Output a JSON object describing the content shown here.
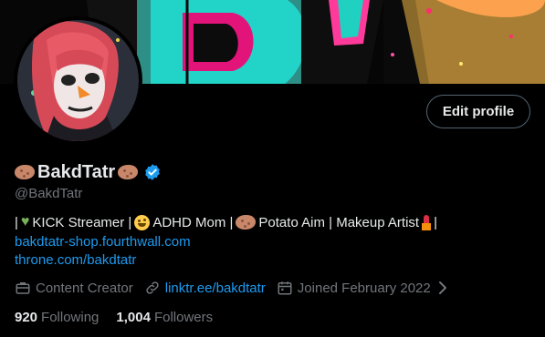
{
  "profile": {
    "display_name": "BakdTatr",
    "handle": "@BakdTatr",
    "verified": true,
    "edit_button_label": "Edit profile"
  },
  "bio": {
    "prefix": "|",
    "part1": "KICK Streamer |",
    "part2": "ADHD Mom |",
    "part3": "Potato Aim | Makeup Artist",
    "suffix": "|",
    "links": [
      "bakdtatr-shop.fourthwall.com",
      "throne.com/bakdtatr"
    ]
  },
  "meta": {
    "category": "Content Creator",
    "website": "linktr.ee/bakdtatr",
    "joined": "Joined February 2022"
  },
  "stats": {
    "following_count": "920",
    "following_label": "Following",
    "followers_count": "1,004",
    "followers_label": "Followers"
  },
  "icons": {
    "verified": "verified-badge-icon",
    "category": "briefcase-icon",
    "website": "link-icon",
    "joined": "calendar-icon",
    "chevron": "chevron-right-icon"
  },
  "colors": {
    "accent": "#1d9bf0",
    "background": "#000000",
    "muted": "#71767b",
    "text": "#e7e9ea",
    "button_border": "#536471"
  }
}
